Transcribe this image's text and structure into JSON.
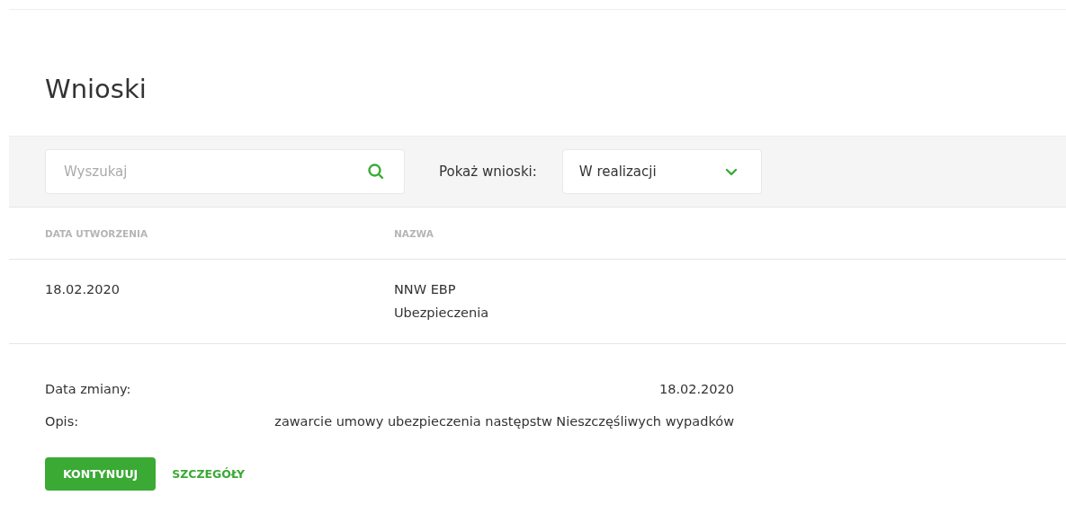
{
  "title": "Wnioski",
  "filters": {
    "search": {
      "placeholder": "Wyszukaj"
    },
    "show_label": "Pokaż wnioski:",
    "show_value": "W realizacji"
  },
  "table": {
    "columns": [
      "DATA UTWORZENIA",
      "NAZWA"
    ],
    "rows": [
      {
        "date": "18.02.2020",
        "name": "NNW EBP",
        "category": "Ubezpieczenia"
      }
    ]
  },
  "details": [
    {
      "label": "Data zmiany:",
      "value": "18.02.2020"
    },
    {
      "label": "Opis:",
      "value": "zawarcie umowy ubezpieczenia następstw Nieszczęśliwych wypadków"
    }
  ],
  "buttons": [
    {
      "kind": "primary",
      "label": "KONTYNUUJ"
    },
    {
      "kind": "link",
      "label": "SZCZEGÓŁY"
    }
  ]
}
